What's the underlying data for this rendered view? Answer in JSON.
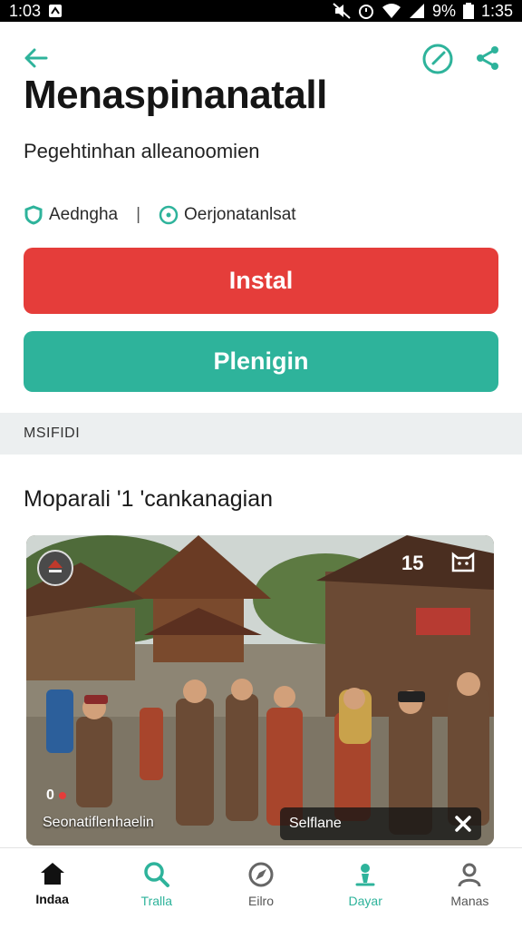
{
  "status_bar": {
    "time_left": "1:03",
    "battery": "9%",
    "time_right": "1:35"
  },
  "header": {
    "back_icon": "arrow-left-icon",
    "clock_icon": "clock-icon",
    "share_icon": "share-icon",
    "accent": "#2eb39b"
  },
  "app": {
    "title": "Menaspinanatall",
    "subtitle": "Pegehtinhan alleanoomien",
    "meta": [
      {
        "icon": "shield-icon",
        "label": "Aedngha"
      },
      {
        "icon": "check-circle-icon",
        "label": "Oerjonatanlsat"
      }
    ]
  },
  "buttons": {
    "install_label": "Instal",
    "install_color": "#e53d3a",
    "secondary_label": "Plenigin",
    "secondary_color": "#2eb39b"
  },
  "section_band": {
    "label": "MSIFIDI"
  },
  "section": {
    "heading": "Moparali  '1 'cankanagian"
  },
  "media": {
    "count": "15",
    "views": "0",
    "caption": "Seonatiflenhaelin",
    "pill_text": "Selflane"
  },
  "bottom_nav": [
    {
      "icon": "home-icon",
      "label": "Indaa"
    },
    {
      "icon": "search-icon",
      "label": "Tralla"
    },
    {
      "icon": "compass-icon",
      "label": "Eilro"
    },
    {
      "icon": "person-pin-icon",
      "label": "Dayar"
    },
    {
      "icon": "profile-icon",
      "label": "Manas"
    }
  ]
}
